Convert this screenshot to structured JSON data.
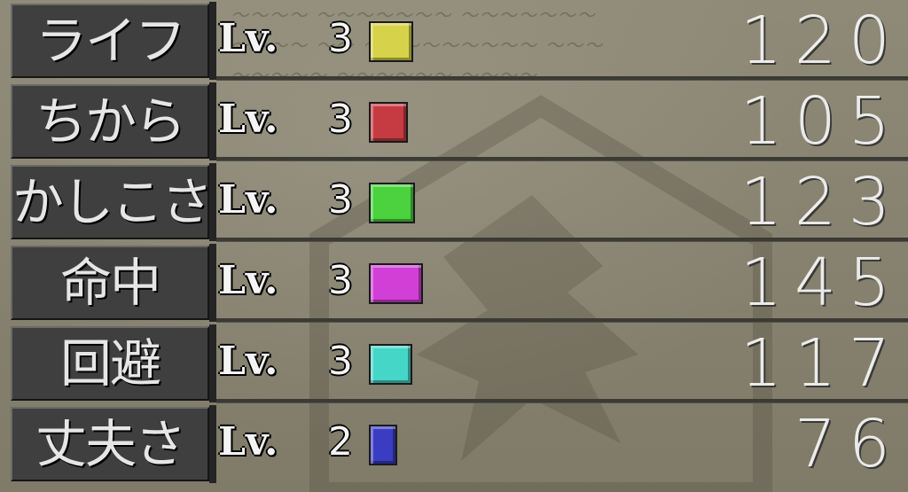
{
  "stats": [
    {
      "name": "ライフ",
      "lv_label": "Lv.",
      "level": "3",
      "value": "120",
      "bar_color": "#d6d24a",
      "bar_fraction": 0.12
    },
    {
      "name": "ちから",
      "lv_label": "Lv.",
      "level": "3",
      "value": "105",
      "bar_color": "#c63b42",
      "bar_fraction": 0.105
    },
    {
      "name": "かしこさ",
      "lv_label": "Lv.",
      "level": "3",
      "value": "123",
      "bar_color": "#4cd13f",
      "bar_fraction": 0.123
    },
    {
      "name": "命中",
      "lv_label": "Lv.",
      "level": "3",
      "value": "145",
      "bar_color": "#d23fd6",
      "bar_fraction": 0.145
    },
    {
      "name": "回避",
      "lv_label": "Lv.",
      "level": "3",
      "value": "117",
      "bar_color": "#46d6c8",
      "bar_fraction": 0.117
    },
    {
      "name": "丈夫さ",
      "lv_label": "Lv.",
      "level": "2",
      "value": "76",
      "bar_color": "#3a3dc2",
      "bar_fraction": 0.076
    }
  ]
}
